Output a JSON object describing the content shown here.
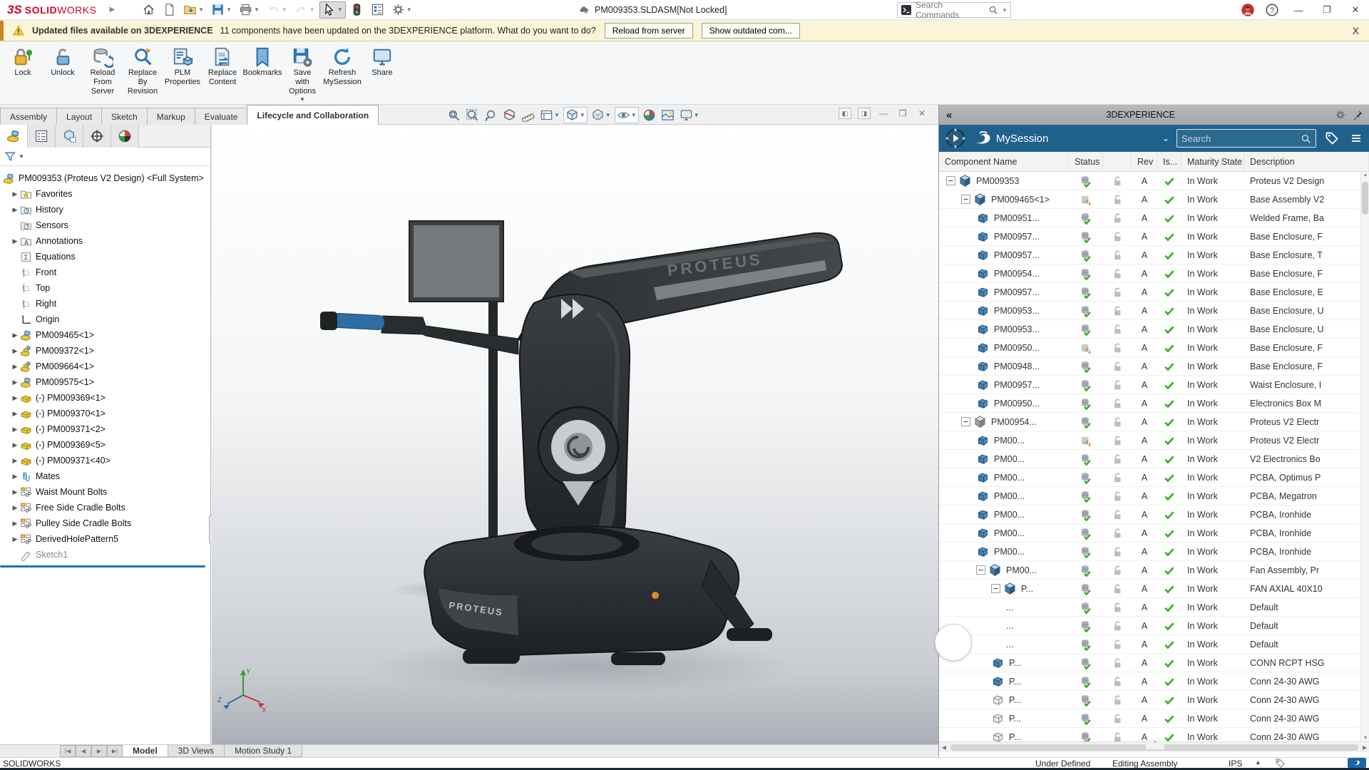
{
  "titlebar": {
    "brand_prefix": "3S",
    "brand_bold": "SOLID",
    "brand_rest": "WORKS",
    "file_title": "PM009353.SLDASM[Not Locked]",
    "search_placeholder": "Search Commands",
    "tools": [
      {
        "icon": "home"
      },
      {
        "icon": "newdoc"
      },
      {
        "icon": "open",
        "caret": true
      },
      {
        "icon": "save",
        "caret": true
      },
      {
        "icon": "print",
        "caret": true
      },
      {
        "icon": "undo",
        "caret": true,
        "disabled": true
      },
      {
        "icon": "redo",
        "caret": true,
        "disabled": true
      },
      {
        "icon": "cursor",
        "caret": true,
        "active": true
      },
      {
        "icon": "traffic"
      },
      {
        "icon": "listicon"
      },
      {
        "icon": "gear",
        "caret": true
      }
    ]
  },
  "notification": {
    "title": "Updated files available on 3DEXPERIENCE",
    "message": "11 components have been updated on the 3DEXPERIENCE platform. What do you want to do?",
    "buttons": [
      "Reload from server",
      "Show outdated com...",
      "X"
    ]
  },
  "ribbon": [
    {
      "icon": "rb-lock",
      "lines": [
        "Lock"
      ]
    },
    {
      "icon": "rb-unlock",
      "lines": [
        "Unlock"
      ]
    },
    {
      "icon": "rb-reload",
      "lines": [
        "Reload",
        "From",
        "Server"
      ]
    },
    {
      "icon": "rb-replrev",
      "lines": [
        "Replace",
        "By",
        "Revision"
      ]
    },
    {
      "icon": "rb-plm",
      "lines": [
        "PLM",
        "Properties"
      ]
    },
    {
      "icon": "rb-replcont",
      "lines": [
        "Replace",
        "Content"
      ]
    },
    {
      "icon": "rb-bookmarks",
      "lines": [
        "Bookmarks"
      ]
    },
    {
      "icon": "rb-saveopts",
      "lines": [
        "Save",
        "with",
        "Options"
      ],
      "caret": true
    },
    {
      "icon": "rb-refresh",
      "lines": [
        "Refresh",
        "MySession"
      ]
    },
    {
      "icon": "rb-share",
      "lines": [
        "Share"
      ]
    }
  ],
  "doc_tabs": [
    {
      "label": "Assembly"
    },
    {
      "label": "Layout"
    },
    {
      "label": "Sketch"
    },
    {
      "label": "Markup"
    },
    {
      "label": "Evaluate"
    },
    {
      "label": "Lifecycle and Collaboration",
      "active": true
    }
  ],
  "hud": [
    {
      "icon": "hud-zoomfit"
    },
    {
      "icon": "hud-zoomarea"
    },
    {
      "icon": "hud-prev"
    },
    {
      "icon": "hud-section"
    },
    {
      "icon": "hud-measure"
    },
    {
      "icon": "hud-sheet",
      "caret": true
    },
    {
      "icon": "hud-cube",
      "caret": true,
      "boxed": true
    },
    {
      "icon": "hud-style",
      "caret": true
    },
    {
      "icon": "hud-eye",
      "caret": true,
      "boxed": true
    },
    {
      "icon": "hud-ball"
    },
    {
      "icon": "hud-scene"
    },
    {
      "icon": "hud-monitor",
      "caret": true
    }
  ],
  "tree": {
    "root": {
      "label": "PM009353 (Proteus V2 Design) <Full System>",
      "icon": "t-asm"
    },
    "items": [
      {
        "label": "Favorites",
        "icon": "t-fav",
        "arrow": true
      },
      {
        "label": "History",
        "icon": "t-hist",
        "arrow": true
      },
      {
        "label": "Sensors",
        "icon": "t-sens",
        "arrow": false
      },
      {
        "label": "Annotations",
        "icon": "t-ann",
        "arrow": true
      },
      {
        "label": "Equations",
        "icon": "t-sigma",
        "arrow": false
      },
      {
        "label": "Front",
        "icon": "t-plane",
        "arrow": false
      },
      {
        "label": "Top",
        "icon": "t-plane",
        "arrow": false
      },
      {
        "label": "Right",
        "icon": "t-plane",
        "arrow": false
      },
      {
        "label": "Origin",
        "icon": "t-origin",
        "arrow": false
      },
      {
        "label": "PM009465<1>",
        "icon": "t-asm",
        "arrow": true
      },
      {
        "label": "PM009372<1>",
        "icon": "t-derived",
        "arrow": true
      },
      {
        "label": "PM009664<1>",
        "icon": "t-derived",
        "arrow": true
      },
      {
        "label": "PM009575<1>",
        "icon": "t-asm",
        "arrow": true
      },
      {
        "label": "(-) PM009369<1>",
        "icon": "t-part",
        "arrow": true
      },
      {
        "label": "(-) PM009370<1>",
        "icon": "t-part",
        "arrow": true
      },
      {
        "label": "(-) PM009371<2>",
        "icon": "t-part",
        "arrow": true
      },
      {
        "label": "(-) PM009369<5>",
        "icon": "t-part",
        "arrow": true
      },
      {
        "label": "(-) PM009371<40>",
        "icon": "t-part",
        "arrow": true
      },
      {
        "label": "Mates",
        "icon": "t-mates",
        "arrow": true
      },
      {
        "label": "Waist Mount Bolts",
        "icon": "t-pattern",
        "arrow": true
      },
      {
        "label": "Free Side Cradle Bolts",
        "icon": "t-pattern",
        "arrow": true
      },
      {
        "label": "Pulley Side Cradle Bolts",
        "icon": "t-pattern",
        "arrow": true
      },
      {
        "label": "DerivedHolePattern5",
        "icon": "t-pattern",
        "arrow": true
      },
      {
        "label": "Sketch1",
        "icon": "t-sketch",
        "arrow": false,
        "dim": true
      }
    ]
  },
  "viewport": {
    "brand_arm": "PROTEUS",
    "brand_base": "PROTEUS",
    "bottom_tabs": [
      {
        "label": "Model",
        "active": true
      },
      {
        "label": "3D Views"
      },
      {
        "label": "Motion Study 1"
      }
    ]
  },
  "panel": {
    "header_title": "3DEXPERIENCE",
    "session_title": "MySession",
    "search_placeholder": "Search",
    "columns": [
      "Component Name",
      "Status",
      "",
      "Rev",
      "Is...",
      "Maturity State",
      "Description"
    ],
    "row_defaults": {
      "rev": "A",
      "maturity": "In Work"
    },
    "rows": [
      {
        "name": "PM009353",
        "level": 0,
        "icon": "casm",
        "status": "db",
        "expand": true,
        "desc": "Proteus V2 Design"
      },
      {
        "name": "PM009465<1>",
        "level": 1,
        "icon": "casm",
        "status": "up",
        "expand": true,
        "desc": "Base Assembly V2"
      },
      {
        "name": "PM00951...",
        "level": 2,
        "icon": "cpart",
        "status": "db",
        "expand": false,
        "desc": "Welded Frame, Ba"
      },
      {
        "name": "PM00957...",
        "level": 2,
        "icon": "cpart",
        "status": "db",
        "expand": false,
        "desc": "Base Enclosure, F"
      },
      {
        "name": "PM00957...",
        "level": 2,
        "icon": "cpart",
        "status": "db",
        "expand": false,
        "desc": "Base Enclosure, T"
      },
      {
        "name": "PM00954...",
        "level": 2,
        "icon": "cpart",
        "status": "db",
        "expand": false,
        "desc": "Base Enclosure, F"
      },
      {
        "name": "PM00957...",
        "level": 2,
        "icon": "cpart",
        "status": "db",
        "expand": false,
        "desc": "Base Enclosure, E"
      },
      {
        "name": "PM00953...",
        "level": 2,
        "icon": "cpart",
        "status": "db",
        "expand": false,
        "desc": "Base Enclosure, U"
      },
      {
        "name": "PM00953...",
        "level": 2,
        "icon": "cpart",
        "status": "db",
        "expand": false,
        "desc": "Base Enclosure, U"
      },
      {
        "name": "PM00950...",
        "level": 2,
        "icon": "cpart",
        "status": "up",
        "expand": false,
        "desc": "Base Enclosure, F"
      },
      {
        "name": "PM00948...",
        "level": 2,
        "icon": "cpart",
        "status": "db",
        "expand": false,
        "desc": "Base Enclosure, F"
      },
      {
        "name": "PM00957...",
        "level": 2,
        "icon": "cpart",
        "status": "db",
        "expand": false,
        "desc": "Waist Enclosure, I"
      },
      {
        "name": "PM00950...",
        "level": 2,
        "icon": "cpart",
        "status": "db",
        "expand": false,
        "desc": "Electronics Box M"
      },
      {
        "name": "PM00954...",
        "level": 1,
        "icon": "casm-gray",
        "status": "db",
        "expand": true,
        "desc": "Proteus V2 Electr"
      },
      {
        "name": "PM00...",
        "level": 2,
        "icon": "cpart",
        "status": "up",
        "expand": false,
        "desc": "Proteus V2 Electr"
      },
      {
        "name": "PM00...",
        "level": 2,
        "icon": "cpart",
        "status": "db",
        "expand": false,
        "desc": "V2 Electronics Bo"
      },
      {
        "name": "PM00...",
        "level": 2,
        "icon": "cpart",
        "status": "db",
        "expand": false,
        "desc": "PCBA, Optimus P"
      },
      {
        "name": "PM00...",
        "level": 2,
        "icon": "cpart",
        "status": "db",
        "expand": false,
        "desc": "PCBA, Megatron"
      },
      {
        "name": "PM00...",
        "level": 2,
        "icon": "cpart",
        "status": "db",
        "expand": false,
        "desc": "PCBA, Ironhide"
      },
      {
        "name": "PM00...",
        "level": 2,
        "icon": "cpart",
        "status": "db",
        "expand": false,
        "desc": "PCBA, Ironhide"
      },
      {
        "name": "PM00...",
        "level": 2,
        "icon": "cpart",
        "status": "db",
        "expand": false,
        "desc": "PCBA, Ironhide"
      },
      {
        "name": "PM00...",
        "level": 2,
        "icon": "casm",
        "status": "db",
        "expand": true,
        "desc": "Fan Assembly, Pr"
      },
      {
        "name": "P...",
        "level": 3,
        "icon": "casm",
        "status": "db",
        "expand": true,
        "desc": "FAN AXIAL 40X10"
      },
      {
        "name": "...",
        "level": 4,
        "icon": "none",
        "status": "db",
        "expand": false,
        "desc": "Default"
      },
      {
        "name": "...",
        "level": 4,
        "icon": "none",
        "status": "db",
        "expand": false,
        "desc": "Default"
      },
      {
        "name": "...",
        "level": 4,
        "icon": "none",
        "status": "db",
        "expand": false,
        "desc": "Default"
      },
      {
        "name": "P...",
        "level": 3,
        "icon": "cpart",
        "status": "db",
        "expand": false,
        "desc": "CONN RCPT HSG"
      },
      {
        "name": "P...",
        "level": 3,
        "icon": "cpart",
        "status": "db",
        "expand": false,
        "desc": "Conn 24-30 AWG"
      },
      {
        "name": "P...",
        "level": 3,
        "icon": "cpart-lt",
        "status": "db",
        "expand": false,
        "desc": "Conn 24-30 AWG"
      },
      {
        "name": "P...",
        "level": 3,
        "icon": "cpart-lt",
        "status": "db",
        "expand": false,
        "desc": "Conn 24-30 AWG"
      },
      {
        "name": "P...",
        "level": 3,
        "icon": "cpart-lt",
        "status": "db",
        "expand": false,
        "desc": "Conn 24-30 AWG"
      }
    ]
  },
  "statusbar": {
    "left": "SOLIDWORKS",
    "item1": "Under Defined",
    "item2": "Editing Assembly",
    "item3": "IPS"
  },
  "colors": {
    "accent_blue": "#20618c",
    "warning_yellow": "#fbf5d8",
    "status_green": "#3fae2a",
    "status_orange": "#e8872b",
    "brand_red": "#d6002a"
  }
}
